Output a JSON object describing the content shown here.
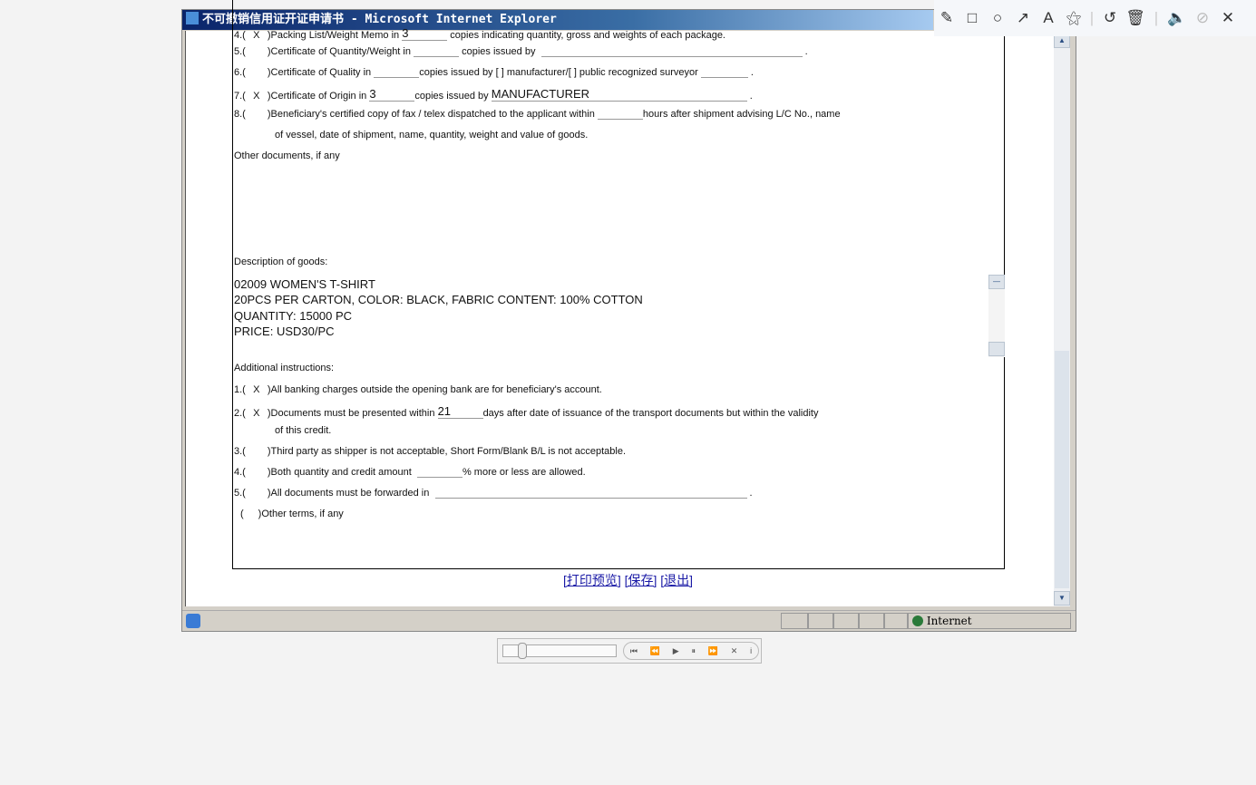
{
  "window": {
    "title": "不可撤销信用证开证申请书 - Microsoft Internet Explorer"
  },
  "documents": [
    {
      "num": "4.(",
      "mark": "X",
      "text": ")Packing List/Weight Memo in",
      "copies": "3",
      "rest": "copies indicating quantity, gross and weights of each package."
    },
    {
      "num": "5.(",
      "mark": "",
      "text": ")Certificate of Quantity/Weight in",
      "copies": "",
      "rest": "copies issued by",
      "issuer": ""
    },
    {
      "num": "6.(",
      "mark": "",
      "text": ")Certificate of Quality in",
      "copies": "",
      "rest": "copies issued by [     ] manufacturer/[     ] public recognized surveyor"
    },
    {
      "num": "7.(",
      "mark": "X",
      "text": ")Certificate of Origin in",
      "copies": "3",
      "rest": "copies issued by",
      "issuer": "MANUFACTURER"
    },
    {
      "num": "8.(",
      "mark": "",
      "text": ")Beneficiary's certified copy of fax / telex dispatched to the applicant within",
      "rest": "hours after shipment advising L/C No., name",
      "cont": "of vessel, date of shipment, name, quantity, weight and value of goods."
    }
  ],
  "other_docs_label": "Other documents, if any",
  "goods_label": "Description of goods:",
  "goods_lines": [
    "02009 WOMEN'S T-SHIRT",
    "20PCS PER CARTON, COLOR: BLACK, FABRIC CONTENT: 100% COTTON",
    "QUANTITY: 15000 PC",
    "PRICE: USD30/PC"
  ],
  "additional_label": "Additional instructions:",
  "instructions": [
    {
      "num": "1.(",
      "mark": "X",
      "text": ")All banking charges outside the opening bank are for beneficiary's account."
    },
    {
      "num": "2.(",
      "mark": "X",
      "text": ")Documents must be presented within",
      "value": "21",
      "rest": "days after date of issuance of the transport documents but within the validity",
      "cont": "of this credit."
    },
    {
      "num": "3.(",
      "mark": "",
      "text": ")Third party as shipper is not acceptable, Short Form/Blank B/L is not acceptable."
    },
    {
      "num": "4.(",
      "mark": "",
      "text": ")Both quantity and credit amount",
      "rest": "% more or less are allowed."
    },
    {
      "num": "5.(",
      "mark": "",
      "text": ")All documents must be forwarded in"
    },
    {
      "num": "(",
      "mark": "",
      "text": ")Other terms, if any"
    }
  ],
  "links": {
    "print": "[打印预览]",
    "save": "[保存]",
    "exit": "[退出]"
  },
  "status": {
    "zone": "Internet"
  }
}
